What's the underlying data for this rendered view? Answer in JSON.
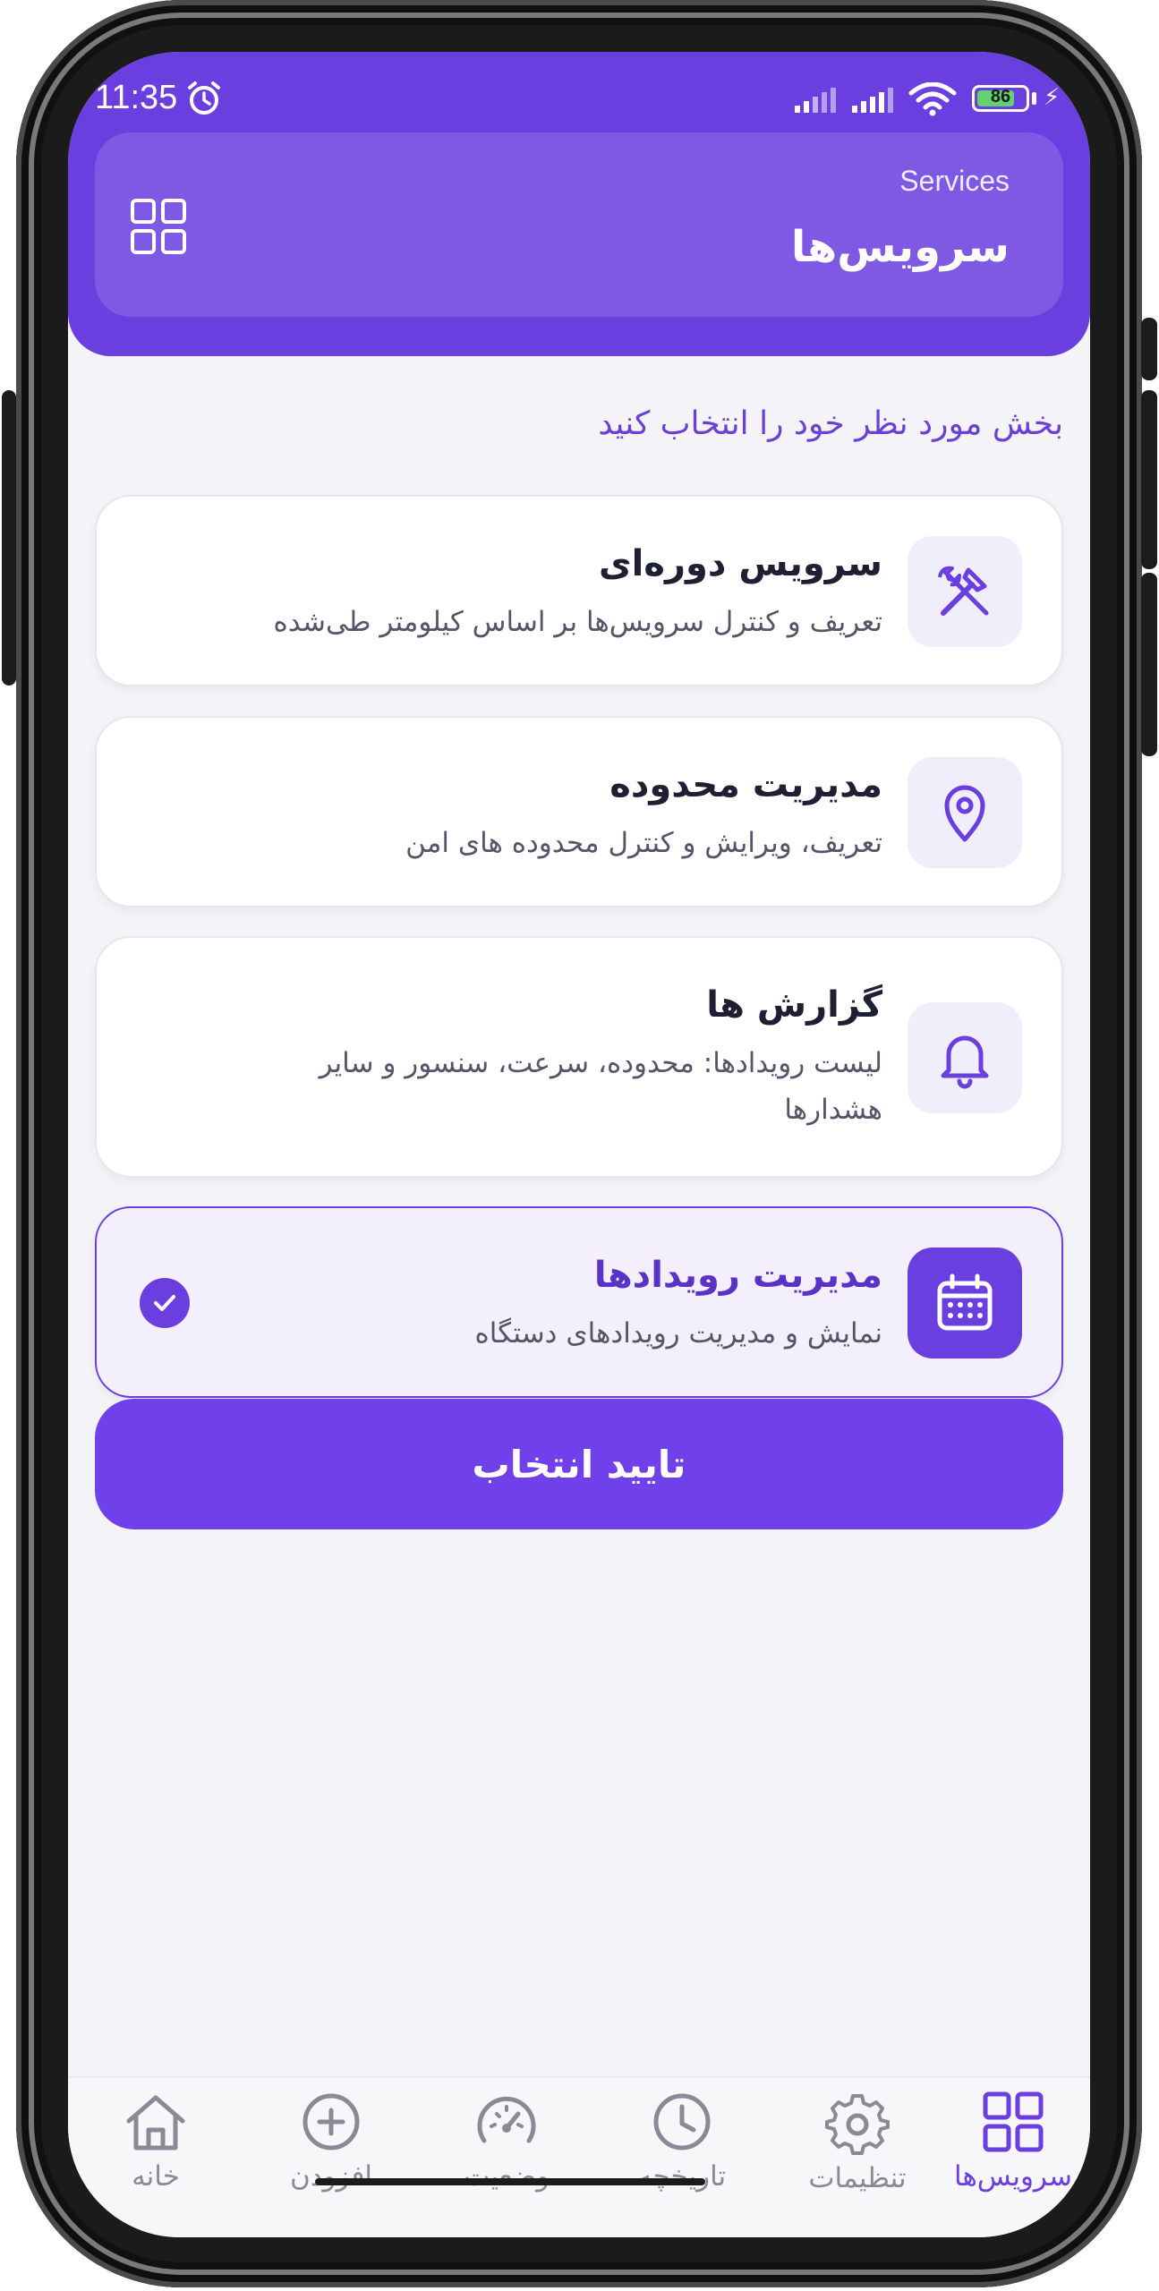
{
  "status_bar": {
    "time": "11:35",
    "battery": "86"
  },
  "header": {
    "subtitle": "Services",
    "title": "سرویس‌ها"
  },
  "instruction": "بخش مورد نظر خود را انتخاب کنید",
  "cards": [
    {
      "title": "سرویس دوره‌ای",
      "desc": "تعریف و کنترل سرویس‌ها بر اساس کیلومتر طی‌شده",
      "icon": "tools-icon",
      "selected": false
    },
    {
      "title": "مدیریت محدوده",
      "desc": "تعریف، ویرایش و کنترل محدوده های امن",
      "icon": "location-pin-icon",
      "selected": false
    },
    {
      "title": "گزارش ها",
      "desc": "لیست رویدادها: محدوده، سرعت، سنسور و سایر هشدارها",
      "icon": "bell-icon",
      "selected": false
    },
    {
      "title": "مدیریت رویدادها",
      "desc": "نمایش و مدیریت رویدادهای دستگاه",
      "icon": "calendar-icon",
      "selected": true
    }
  ],
  "confirm_label": "تایید انتخاب",
  "nav": [
    {
      "label": "خانه",
      "icon": "home-icon",
      "active": false
    },
    {
      "label": "افزودن",
      "icon": "plus-circle-icon",
      "active": false
    },
    {
      "label": "وضعیت",
      "icon": "gauge-icon",
      "active": false
    },
    {
      "label": "تاریخچه",
      "icon": "clock-icon",
      "active": false
    },
    {
      "label": "تنظیمات",
      "icon": "gear-icon",
      "active": false
    },
    {
      "label": "سرویس‌ها",
      "icon": "grid-icon",
      "active": true
    }
  ],
  "colors": {
    "primary": "#6b3ee0",
    "background": "#f4f4f8"
  }
}
